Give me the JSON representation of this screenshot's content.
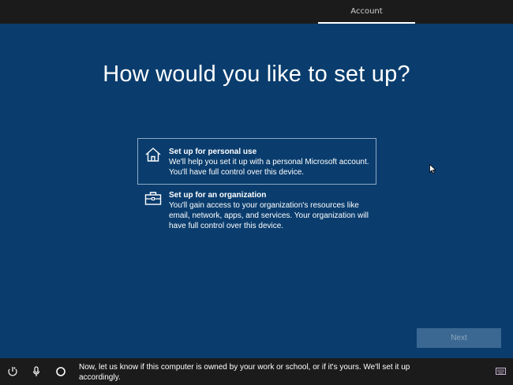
{
  "header": {
    "tab_label": "Account"
  },
  "main": {
    "title": "How would you like to set up?",
    "options": [
      {
        "icon": "home-icon",
        "title": "Set up for personal use",
        "description": "We'll help you set it up with a personal Microsoft account. You'll have full control over this device.",
        "selected": true
      },
      {
        "icon": "briefcase-icon",
        "title": "Set up for an organization",
        "description": "You'll gain access to your organization's resources like email, network, apps, and services. Your organization will have full control over this device.",
        "selected": false
      }
    ],
    "next_label": "Next"
  },
  "footer": {
    "narration": "Now, let us know if this computer is owned by your work or school, or if it's yours. We'll set it up accordingly.",
    "icons": [
      "ease-of-access-icon",
      "microphone-icon",
      "cortana-icon",
      "keyboard-icon"
    ]
  },
  "colors": {
    "background": "#0a3d6e",
    "bar": "#1b1b1b",
    "next_button": "#3a6892"
  }
}
